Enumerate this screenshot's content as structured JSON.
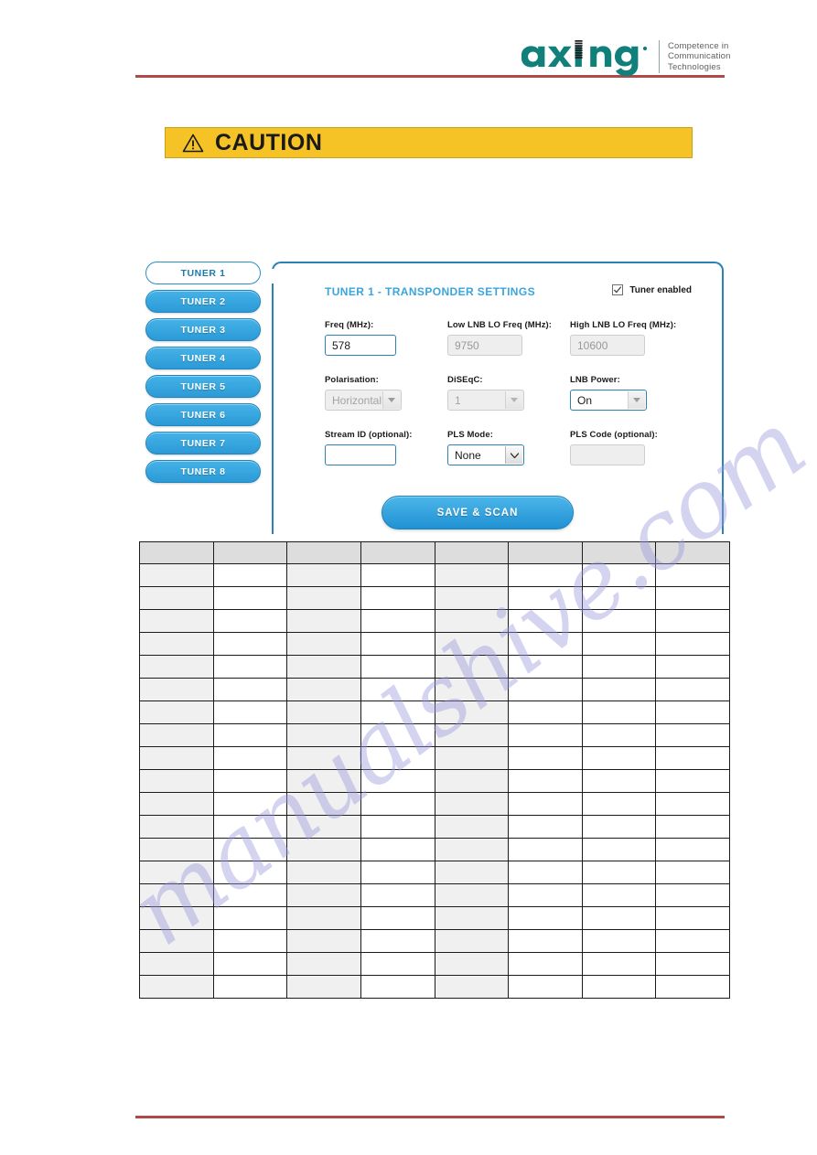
{
  "page": {
    "watermark_text": "manualshive.com",
    "rule_color": "#b04a4a"
  },
  "header": {
    "brand": "axing",
    "tagline_line1": "Competence in",
    "tagline_line2": "Communication",
    "tagline_line3": "Technologies"
  },
  "caution": {
    "label": "CAUTION",
    "icon": "warning-triangle-icon",
    "background_color": "#f5c325"
  },
  "ui": {
    "accent_color": "#2b9ad6",
    "title_color": "#3aa5dc",
    "tabs": [
      {
        "label": "TUNER 1",
        "active": true
      },
      {
        "label": "TUNER 2",
        "active": false
      },
      {
        "label": "TUNER 3",
        "active": false
      },
      {
        "label": "TUNER 4",
        "active": false
      },
      {
        "label": "TUNER 5",
        "active": false
      },
      {
        "label": "TUNER 6",
        "active": false
      },
      {
        "label": "TUNER 7",
        "active": false
      },
      {
        "label": "TUNER 8",
        "active": false
      }
    ],
    "panel": {
      "title": "TUNER 1 - TRANSPONDER SETTINGS",
      "tuner_enabled_label": "Tuner enabled",
      "tuner_enabled_checked": true,
      "fields": {
        "freq_label": "Freq (MHz):",
        "freq_value": "578",
        "low_lnb_label": "Low LNB LO Freq (MHz):",
        "low_lnb_value": "9750",
        "high_lnb_label": "High LNB LO Freq (MHz):",
        "high_lnb_value": "10600",
        "polarisation_label": "Polarisation:",
        "polarisation_value": "Horizontal",
        "diseqc_label": "DiSEqC:",
        "diseqc_value": "1",
        "lnb_power_label": "LNB Power:",
        "lnb_power_value": "On",
        "stream_id_label": "Stream ID (optional):",
        "stream_id_value": "",
        "pls_mode_label": "PLS Mode:",
        "pls_mode_value": "None",
        "pls_code_label": "PLS Code (optional):",
        "pls_code_value": ""
      },
      "save_scan_label": "SAVE & SCAN"
    }
  },
  "table": {
    "headers": [
      "",
      "",
      "",
      "",
      "",
      "",
      "",
      ""
    ],
    "rows": [
      [
        "",
        "",
        "",
        "",
        "",
        "",
        "",
        ""
      ],
      [
        "",
        "",
        "",
        "",
        "",
        "",
        "",
        ""
      ],
      [
        "",
        "",
        "",
        "",
        "",
        "",
        "",
        ""
      ],
      [
        "",
        "",
        "",
        "",
        "",
        "",
        "",
        ""
      ],
      [
        "",
        "",
        "",
        "",
        "",
        "",
        "",
        ""
      ],
      [
        "",
        "",
        "",
        "",
        "",
        "",
        "",
        ""
      ],
      [
        "",
        "",
        "",
        "",
        "",
        "",
        "",
        ""
      ],
      [
        "",
        "",
        "",
        "",
        "",
        "",
        "",
        ""
      ],
      [
        "",
        "",
        "",
        "",
        "",
        "",
        "",
        ""
      ],
      [
        "",
        "",
        "",
        "",
        "",
        "",
        "",
        ""
      ],
      [
        "",
        "",
        "",
        "",
        "",
        "",
        "",
        ""
      ],
      [
        "",
        "",
        "",
        "",
        "",
        "",
        "",
        ""
      ],
      [
        "",
        "",
        "",
        "",
        "",
        "",
        "",
        ""
      ],
      [
        "",
        "",
        "",
        "",
        "",
        "",
        "",
        ""
      ],
      [
        "",
        "",
        "",
        "",
        "",
        "",
        "",
        ""
      ],
      [
        "",
        "",
        "",
        "",
        "",
        "",
        "",
        ""
      ],
      [
        "",
        "",
        "",
        "",
        "",
        "",
        "",
        ""
      ],
      [
        "",
        "",
        "",
        "",
        "",
        "",
        "",
        ""
      ],
      [
        "",
        "",
        "",
        "",
        "",
        "",
        "",
        ""
      ]
    ],
    "shaded_columns": [
      0,
      2,
      4
    ]
  }
}
